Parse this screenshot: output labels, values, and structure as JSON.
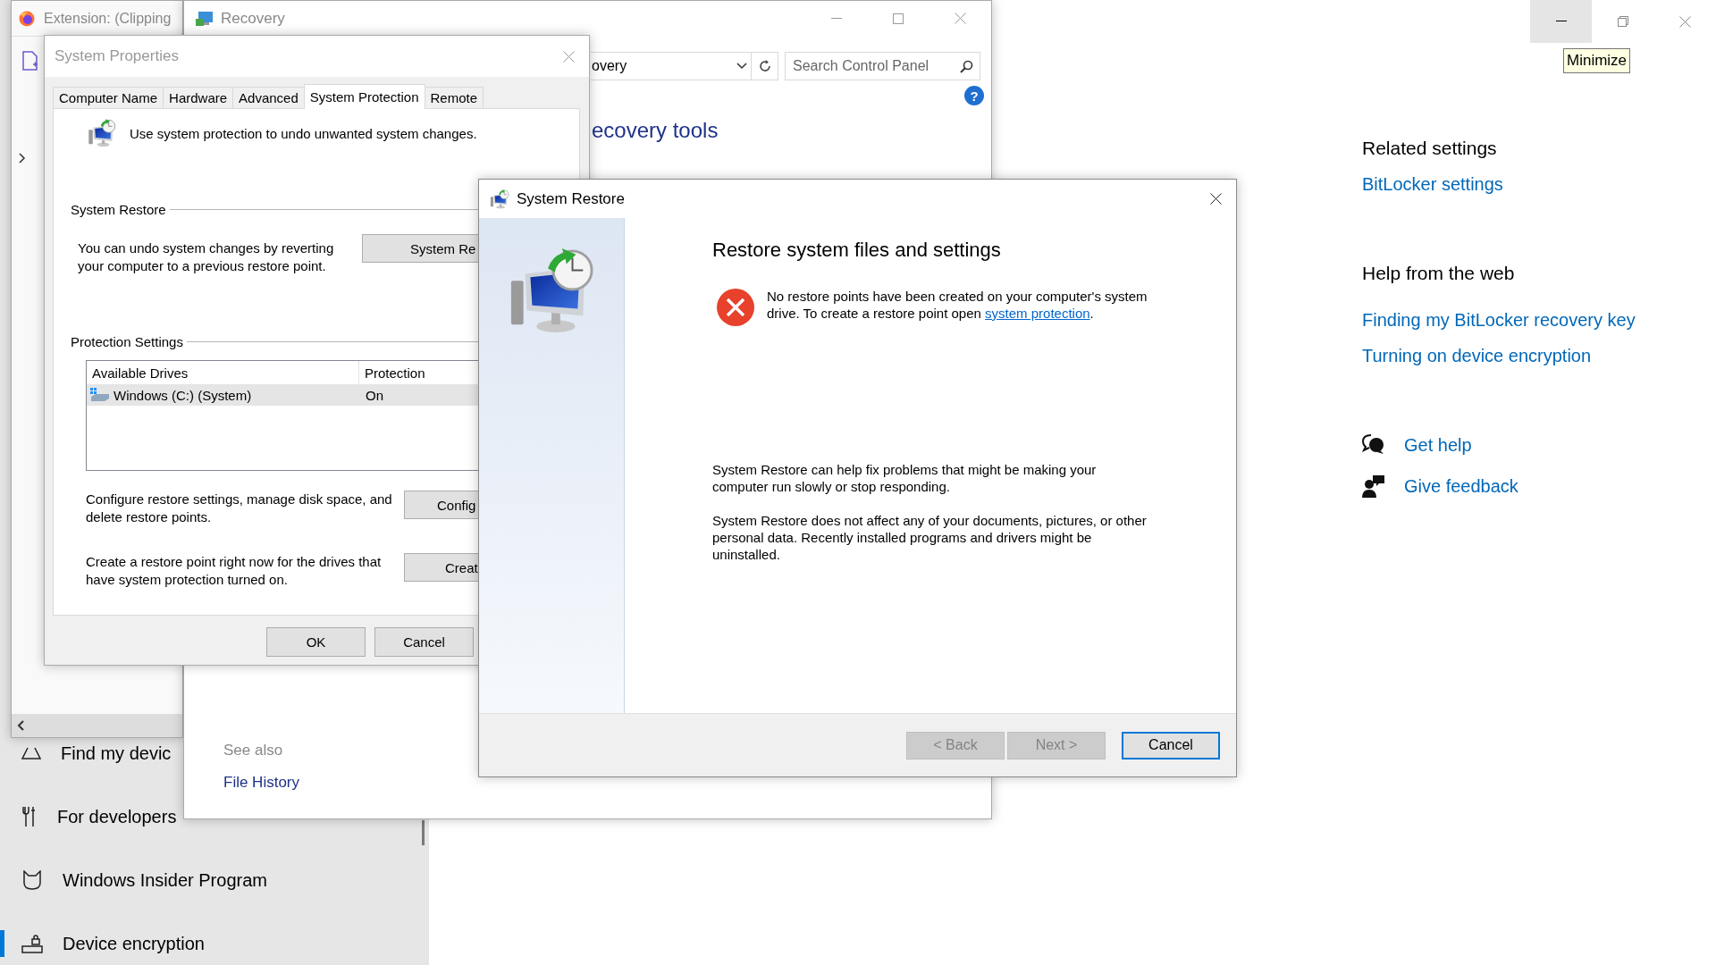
{
  "settings": {
    "sidebar": {
      "items": [
        {
          "kind": "find",
          "label": "Find my devic",
          "selected": false
        },
        {
          "kind": "developers",
          "label": "For developers",
          "selected": false
        },
        {
          "kind": "insider",
          "label": "Windows Insider Program",
          "selected": false
        },
        {
          "kind": "encryption",
          "label": "Device encryption",
          "selected": true
        }
      ]
    },
    "caption_buttons": [
      {
        "kind": "minimize",
        "hovered": true
      },
      {
        "kind": "restore",
        "hovered": false
      },
      {
        "kind": "close",
        "hovered": false
      }
    ],
    "tooltip": "Minimize",
    "related_settings": {
      "heading": "Related settings",
      "links": [
        "BitLocker settings"
      ]
    },
    "help_from_web": {
      "heading": "Help from the web",
      "links": [
        "Finding my BitLocker recovery key",
        "Turning on device encryption"
      ]
    },
    "support_links": [
      {
        "kind": "help",
        "label": "Get help"
      },
      {
        "kind": "feedback",
        "label": "Give feedback"
      }
    ]
  },
  "firefox_window": {
    "title": "Extension: (Clipping"
  },
  "recovery_window": {
    "title": "Recovery",
    "address": "overy",
    "search": {
      "placeholder": "Search Control Panel"
    },
    "help_glyph": "?",
    "heading": "ecovery tools",
    "see_also": {
      "heading": "See also",
      "links": [
        "File History"
      ]
    }
  },
  "system_properties": {
    "title": "System Properties",
    "tabs": [
      {
        "label": "Computer Name",
        "selected": false
      },
      {
        "label": "Hardware",
        "selected": false
      },
      {
        "label": "Advanced",
        "selected": false
      },
      {
        "label": "System Protection",
        "selected": true
      },
      {
        "label": "Remote",
        "selected": false
      }
    ],
    "intro": "Use system protection to undo unwanted system changes.",
    "system_restore": {
      "label": "System Restore",
      "description": "You can undo system changes by reverting your computer to a previous restore point.",
      "button": "System Re"
    },
    "protection_settings": {
      "label": "Protection Settings",
      "columns": [
        "Available Drives",
        "Protection"
      ],
      "rows": [
        {
          "drive": "Windows (C:) (System)",
          "protection": "On",
          "selected": true
        }
      ],
      "configure": {
        "description": "Configure restore settings, manage disk space, and delete restore points.",
        "button": "Config"
      },
      "create": {
        "description": "Create a restore point right now for the drives that have system protection turned on.",
        "button": "Creat"
      }
    },
    "buttons": [
      "OK",
      "Cancel"
    ]
  },
  "system_restore_dialog": {
    "title": "System Restore",
    "heading": "Restore system files and settings",
    "error_message": {
      "text": "No restore points have been created on your computer's system drive. To create a restore point open",
      "link": "system protection",
      "suffix": "."
    },
    "paragraphs": [
      "System Restore can help fix problems that might be making your computer run slowly or stop responding.",
      "System Restore does not affect any of your documents, pictures, or other personal data. Recently installed programs and drivers might be uninstalled."
    ],
    "buttons": [
      {
        "label": "< Back",
        "disabled": true,
        "default": false
      },
      {
        "label": "Next >",
        "disabled": true,
        "default": false
      },
      {
        "label": "Cancel",
        "disabled": false,
        "default": true
      }
    ]
  }
}
